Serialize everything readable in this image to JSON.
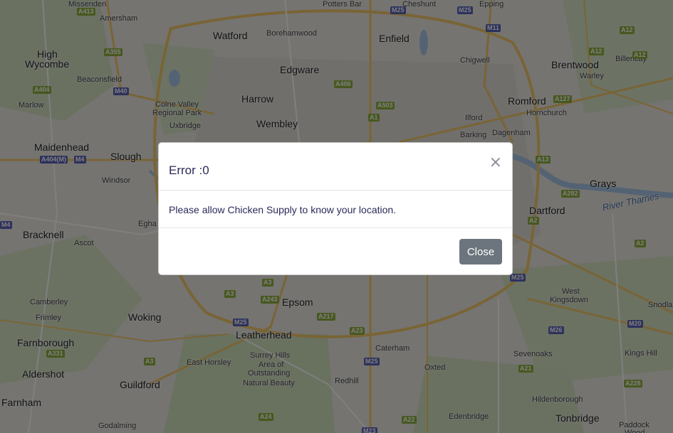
{
  "map": {
    "places": [
      {
        "name": "Amersham",
        "cls": "small"
      },
      {
        "name": "High",
        "cls": "big"
      },
      {
        "name": "Wycombe",
        "cls": "big"
      },
      {
        "name": "Beaconsfield",
        "cls": "small"
      },
      {
        "name": "Marlow",
        "cls": "small"
      },
      {
        "name": "Watford",
        "cls": "big"
      },
      {
        "name": "Borehamwood",
        "cls": "small"
      },
      {
        "name": "Enfield",
        "cls": "big"
      },
      {
        "name": "Edgware",
        "cls": "big"
      },
      {
        "name": "Harrow",
        "cls": "big"
      },
      {
        "name": "Wembley",
        "cls": "big"
      },
      {
        "name": "Colne Valley",
        "cls": "small"
      },
      {
        "name": "Regional Park",
        "cls": "small"
      },
      {
        "name": "Uxbridge",
        "cls": "small"
      },
      {
        "name": "Maidenhead",
        "cls": "big"
      },
      {
        "name": "Slough",
        "cls": "big"
      },
      {
        "name": "Windsor",
        "cls": "small"
      },
      {
        "name": "Chigwell",
        "cls": "small"
      },
      {
        "name": "Romford",
        "cls": "big"
      },
      {
        "name": "Hornchurch",
        "cls": "small"
      },
      {
        "name": "Ilford",
        "cls": "small"
      },
      {
        "name": "Barking",
        "cls": "small"
      },
      {
        "name": "Dagenham",
        "cls": "small"
      },
      {
        "name": "Brentwood",
        "cls": "big"
      },
      {
        "name": "Warley",
        "cls": "small"
      },
      {
        "name": "Billericay",
        "cls": "small"
      },
      {
        "name": "Grays",
        "cls": "big"
      },
      {
        "name": "Dartford",
        "cls": "big"
      },
      {
        "name": "River Thames",
        "cls": "water"
      },
      {
        "name": "Bracknell",
        "cls": "big"
      },
      {
        "name": "Ascot",
        "cls": "small"
      },
      {
        "name": "Egha",
        "cls": "small"
      },
      {
        "name": "Camberley",
        "cls": "small"
      },
      {
        "name": "Frimley",
        "cls": "small"
      },
      {
        "name": "Woking",
        "cls": "big"
      },
      {
        "name": "Farnborough",
        "cls": "big"
      },
      {
        "name": "Aldershot",
        "cls": "big"
      },
      {
        "name": "Guildford",
        "cls": "big"
      },
      {
        "name": "Farnham",
        "cls": "big"
      },
      {
        "name": "Godalming",
        "cls": "small"
      },
      {
        "name": "Epsom",
        "cls": "big"
      },
      {
        "name": "Leatherhead",
        "cls": "big"
      },
      {
        "name": "East Horsley",
        "cls": "small"
      },
      {
        "name": "Surrey Hills",
        "cls": "small"
      },
      {
        "name": "Area of",
        "cls": "small"
      },
      {
        "name": "Outstanding",
        "cls": "small"
      },
      {
        "name": "Natural Beauty",
        "cls": "small"
      },
      {
        "name": "Caterham",
        "cls": "small"
      },
      {
        "name": "Oxted",
        "cls": "small"
      },
      {
        "name": "Redhill",
        "cls": "small"
      },
      {
        "name": "West",
        "cls": "small"
      },
      {
        "name": "Kingsdown",
        "cls": "small"
      },
      {
        "name": "Sevenoaks",
        "cls": "small"
      },
      {
        "name": "Kings Hill",
        "cls": "small"
      },
      {
        "name": "Hildenborough",
        "cls": "small"
      },
      {
        "name": "Tonbridge",
        "cls": "big"
      },
      {
        "name": "Edenbridge",
        "cls": "small"
      },
      {
        "name": "Paddock",
        "cls": "small"
      },
      {
        "name": "Wood",
        "cls": "small"
      },
      {
        "name": "Snodla",
        "cls": "small"
      },
      {
        "name": "Potters Bar",
        "cls": "small"
      },
      {
        "name": "Cheshunt",
        "cls": "small"
      },
      {
        "name": "Epping",
        "cls": "small"
      },
      {
        "name": "Missenden",
        "cls": "small"
      }
    ],
    "shields": [
      {
        "label": "A413",
        "type": "a"
      },
      {
        "label": "A355",
        "type": "a"
      },
      {
        "label": "A404",
        "type": "a"
      },
      {
        "label": "M40",
        "type": "m"
      },
      {
        "label": "A404(M)",
        "type": "m"
      },
      {
        "label": "M4",
        "type": "m"
      },
      {
        "label": "M25",
        "type": "m"
      },
      {
        "label": "M25",
        "type": "m"
      },
      {
        "label": "M11",
        "type": "m"
      },
      {
        "label": "A12",
        "type": "a"
      },
      {
        "label": "A12",
        "type": "a"
      },
      {
        "label": "A12",
        "type": "a"
      },
      {
        "label": "A127",
        "type": "a"
      },
      {
        "label": "A406",
        "type": "a"
      },
      {
        "label": "A503",
        "type": "a"
      },
      {
        "label": "A1",
        "type": "a"
      },
      {
        "label": "A13",
        "type": "a"
      },
      {
        "label": "A282",
        "type": "a"
      },
      {
        "label": "A2",
        "type": "a"
      },
      {
        "label": "A2",
        "type": "a"
      },
      {
        "label": "M25",
        "type": "m"
      },
      {
        "label": "A3",
        "type": "a"
      },
      {
        "label": "A3",
        "type": "a"
      },
      {
        "label": "A243",
        "type": "a"
      },
      {
        "label": "A217",
        "type": "a"
      },
      {
        "label": "A23",
        "type": "a"
      },
      {
        "label": "M25",
        "type": "m"
      },
      {
        "label": "A331",
        "type": "a"
      },
      {
        "label": "A3",
        "type": "a"
      },
      {
        "label": "M25",
        "type": "m"
      },
      {
        "label": "M26",
        "type": "m"
      },
      {
        "label": "M20",
        "type": "m"
      },
      {
        "label": "A21",
        "type": "a"
      },
      {
        "label": "A228",
        "type": "a"
      },
      {
        "label": "A24",
        "type": "a"
      },
      {
        "label": "A22",
        "type": "a"
      },
      {
        "label": "M23",
        "type": "m"
      },
      {
        "label": "M4",
        "type": "m"
      }
    ]
  },
  "modal": {
    "title": "Error :0",
    "close_icon": "×",
    "message": "Please allow Chicken Supply to know your location.",
    "close_label": "Close"
  }
}
